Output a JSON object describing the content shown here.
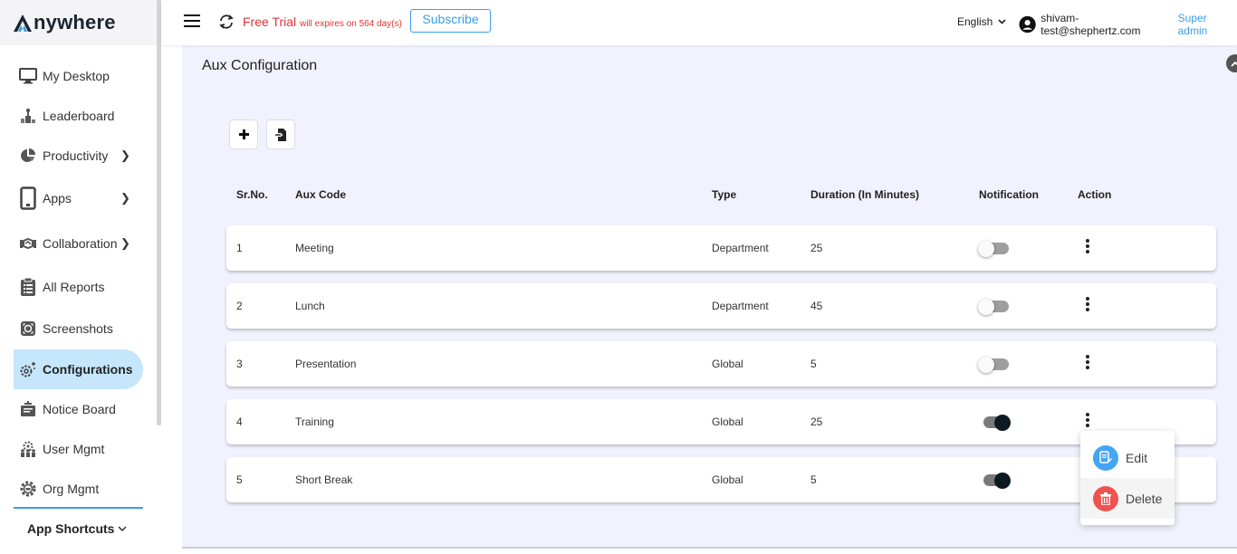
{
  "app": {
    "logo_text": "nywhere",
    "brand_color": "#1b2531",
    "accent_color": "#3a9ee8"
  },
  "topbar": {
    "trial_label": "Free Trial",
    "trial_note": "will expires on 564 day(s)",
    "subscribe_label": "Subscribe",
    "language": "English",
    "user_email": "shivam-test@shephertz.com",
    "user_role": "Super admin"
  },
  "sidebar": {
    "items": [
      {
        "label": "My Desktop",
        "icon": "desktop-icon"
      },
      {
        "label": "Leaderboard",
        "icon": "leaderboard-icon"
      },
      {
        "label": "Productivity",
        "icon": "pie-chart-icon",
        "has_submenu": true
      },
      {
        "label": "Apps",
        "icon": "tablet-icon",
        "has_submenu": true
      },
      {
        "label": "Collaboration",
        "icon": "handshake-icon",
        "has_submenu": true
      },
      {
        "label": "All Reports",
        "icon": "clipboard-list-icon"
      },
      {
        "label": "Screenshots",
        "icon": "screenshot-icon"
      },
      {
        "label": "Configurations",
        "icon": "gear-icon",
        "active": true
      },
      {
        "label": "Notice Board",
        "icon": "notice-board-icon"
      },
      {
        "label": "User Mgmt",
        "icon": "user-group-icon"
      },
      {
        "label": "Org Mgmt",
        "icon": "org-gear-icon"
      }
    ],
    "shortcuts_label": "App Shortcuts"
  },
  "main": {
    "title": "Aux Configuration",
    "columns": [
      "Sr.No.",
      "Aux Code",
      "Type",
      "Duration (In Minutes)",
      "Notification",
      "Action"
    ],
    "rows": [
      {
        "sr": "1",
        "code": "Meeting",
        "type": "Department",
        "duration": "25",
        "notification": false
      },
      {
        "sr": "2",
        "code": "Lunch",
        "type": "Department",
        "duration": "45",
        "notification": false
      },
      {
        "sr": "3",
        "code": "Presentation",
        "type": "Global",
        "duration": "5",
        "notification": false
      },
      {
        "sr": "4",
        "code": "Training",
        "type": "Global",
        "duration": "25",
        "notification": true
      },
      {
        "sr": "5",
        "code": "Short Break",
        "type": "Global",
        "duration": "5",
        "notification": true
      }
    ],
    "action_menu": {
      "open_for_row": "4",
      "items": [
        {
          "label": "Edit",
          "icon": "edit-icon",
          "color": "#42a5f5"
        },
        {
          "label": "Delete",
          "icon": "trash-icon",
          "color": "#ef5350"
        }
      ]
    }
  }
}
